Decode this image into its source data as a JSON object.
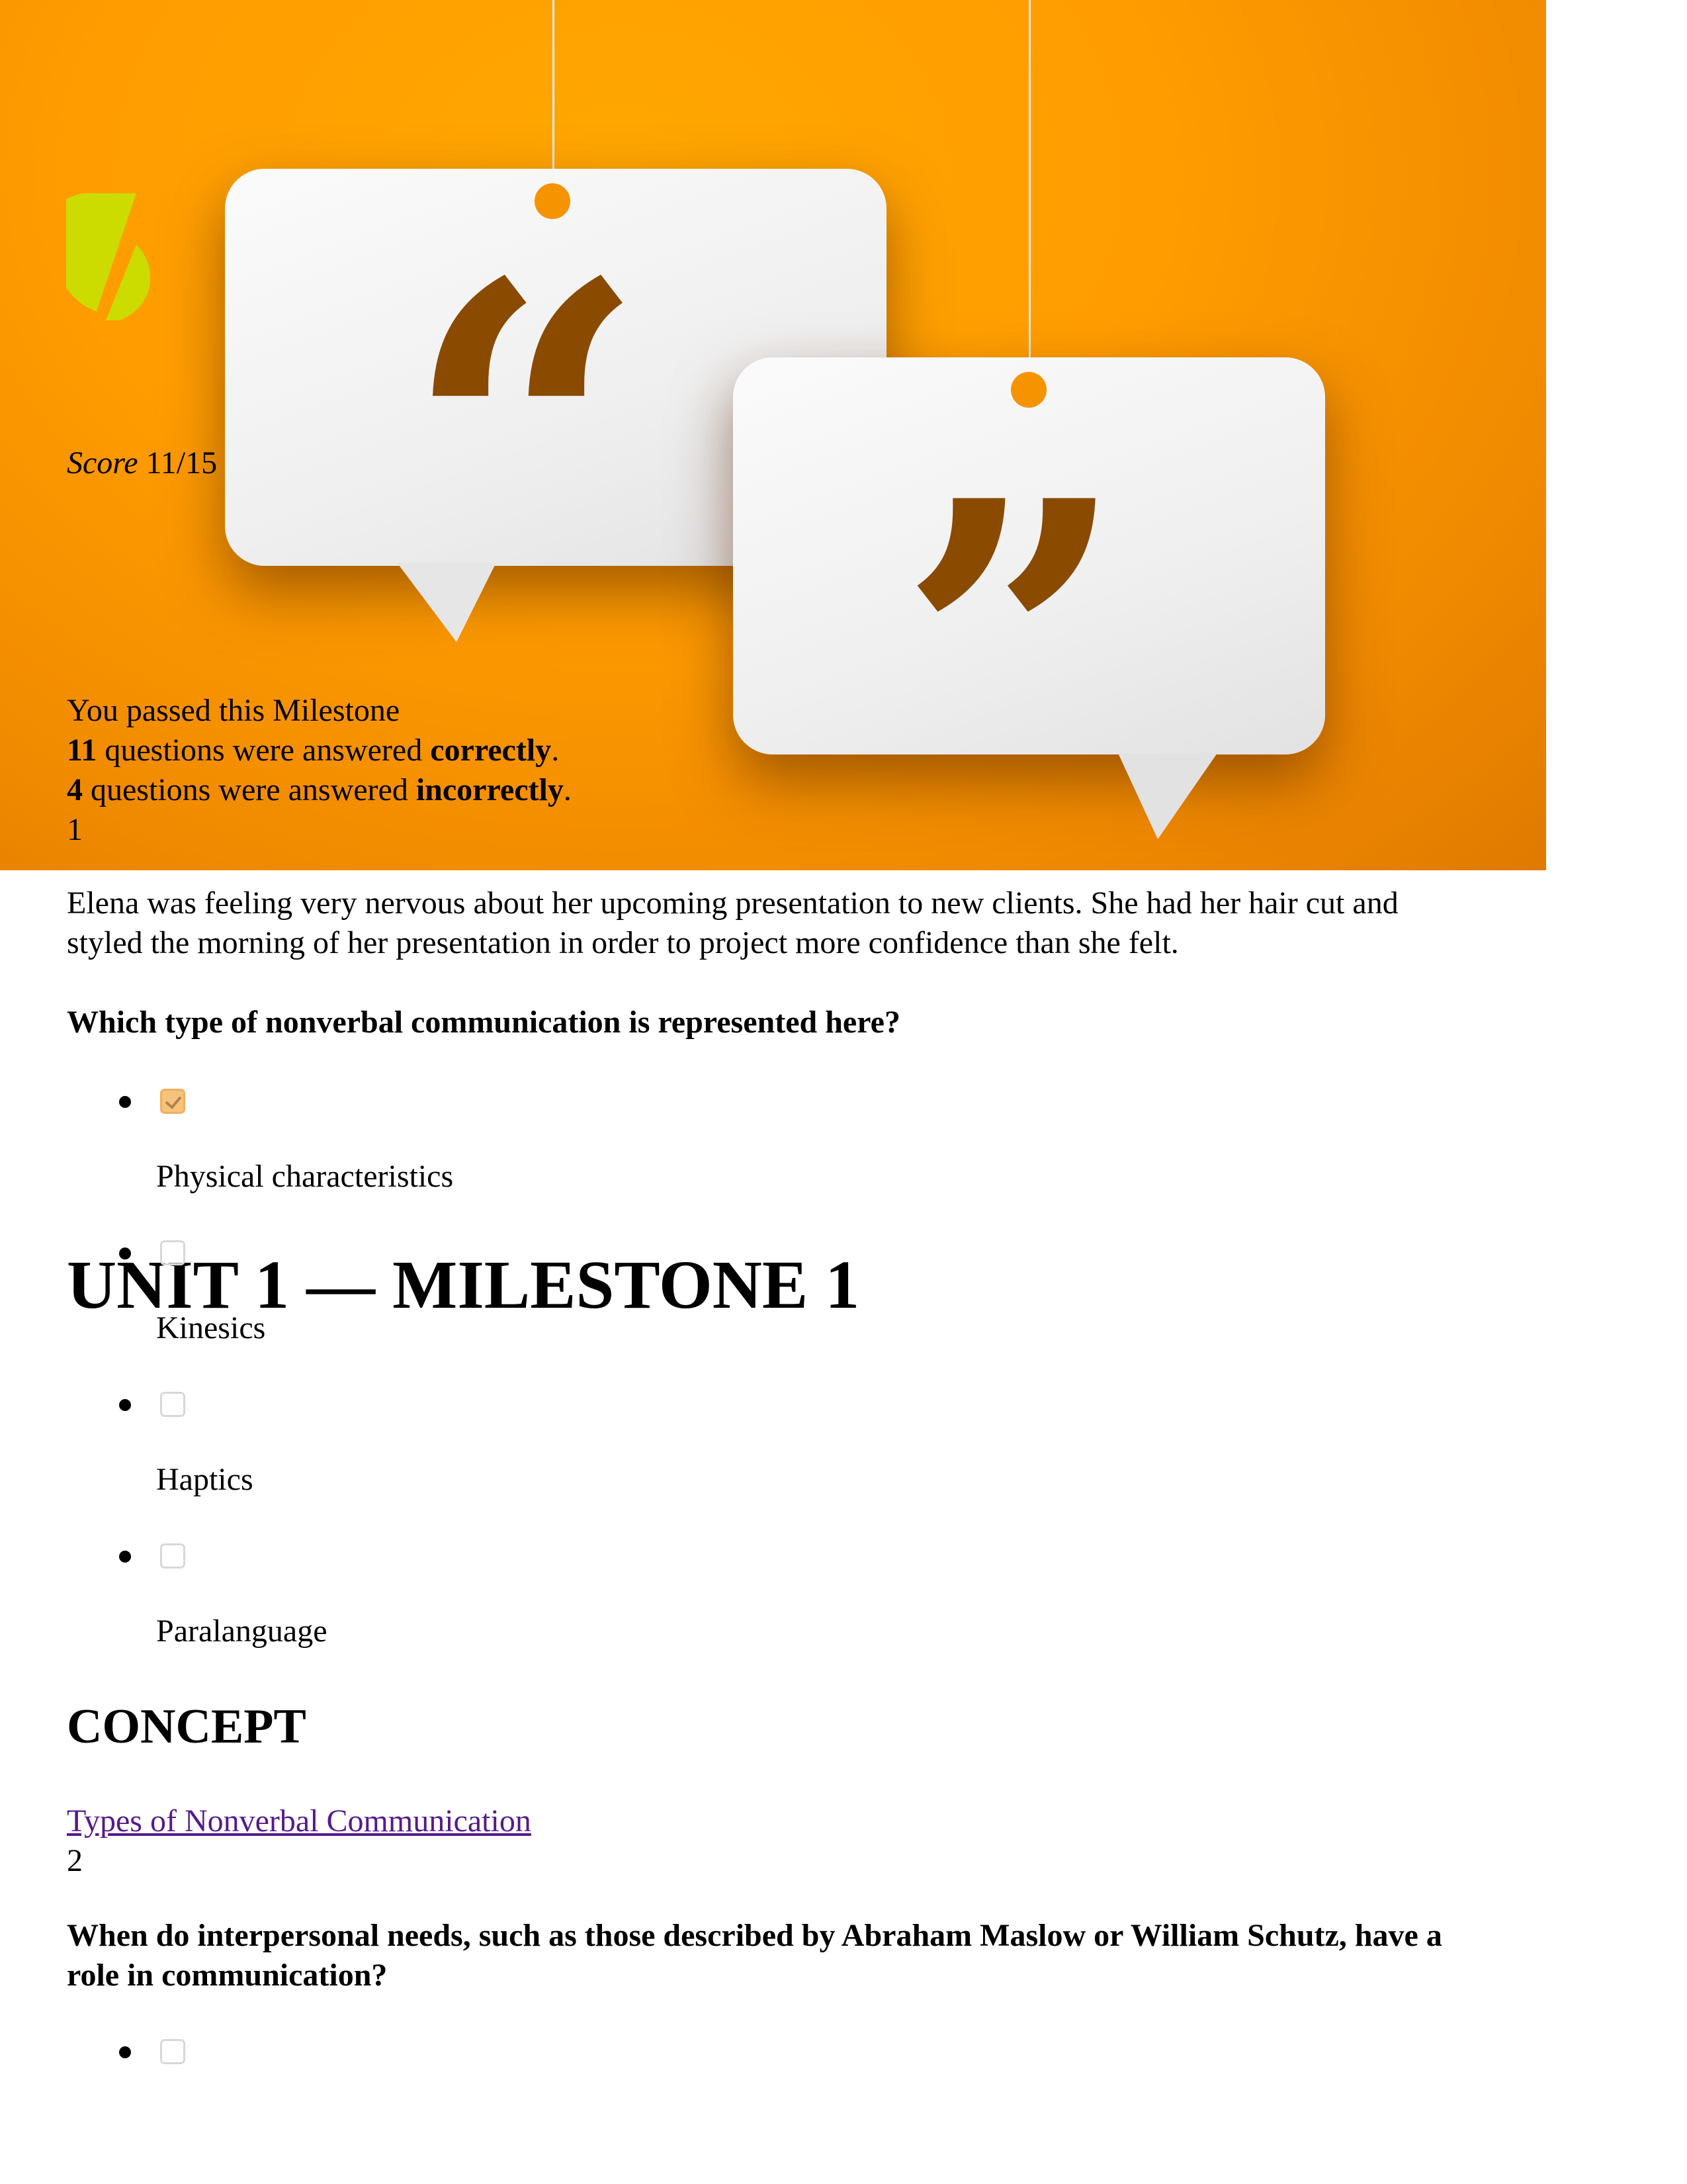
{
  "brand": {
    "logo_icon": "sophia-logo-icon",
    "logo_color": "#cddc00"
  },
  "banner": {
    "image": "speech-bubbles-quote-marks-image",
    "bg_color": "#ff9d00",
    "quote_open": "“",
    "quote_close": "”"
  },
  "score": {
    "label": "Score",
    "value": "11/15"
  },
  "result": {
    "status": "You passed this Milestone",
    "correct_count": "11",
    "correct_text": " questions were answered ",
    "correct_word": "correctly",
    "incorrect_count": "4",
    "incorrect_text": " questions were answered ",
    "incorrect_word": "incorrectly",
    "period": "."
  },
  "page_title": "UNIT 1 — MILESTONE 1",
  "questions": [
    {
      "number": "1",
      "scenario_line1": "Elena was feeling very nervous about her upcoming presentation to new clients. She had her hair cut and",
      "scenario_line2": "styled the morning of her presentation in order to project more confidence than she felt.",
      "prompt": "Which type of nonverbal communication is represented here?",
      "options": [
        {
          "label": "Physical characteristics",
          "checked": true
        },
        {
          "label": "Kinesics",
          "checked": false
        },
        {
          "label": "Haptics",
          "checked": false
        },
        {
          "label": "Paralanguage",
          "checked": false
        }
      ],
      "concept_heading": "CONCEPT",
      "concept_link": "Types of Nonverbal Communication"
    },
    {
      "number": "2",
      "prompt_line1": "When do interpersonal needs, such as those described by Abraham Maslow or William Schutz, have a",
      "prompt_line2": "role in communication?",
      "options": [
        {
          "label": "",
          "checked": false
        }
      ]
    }
  ]
}
